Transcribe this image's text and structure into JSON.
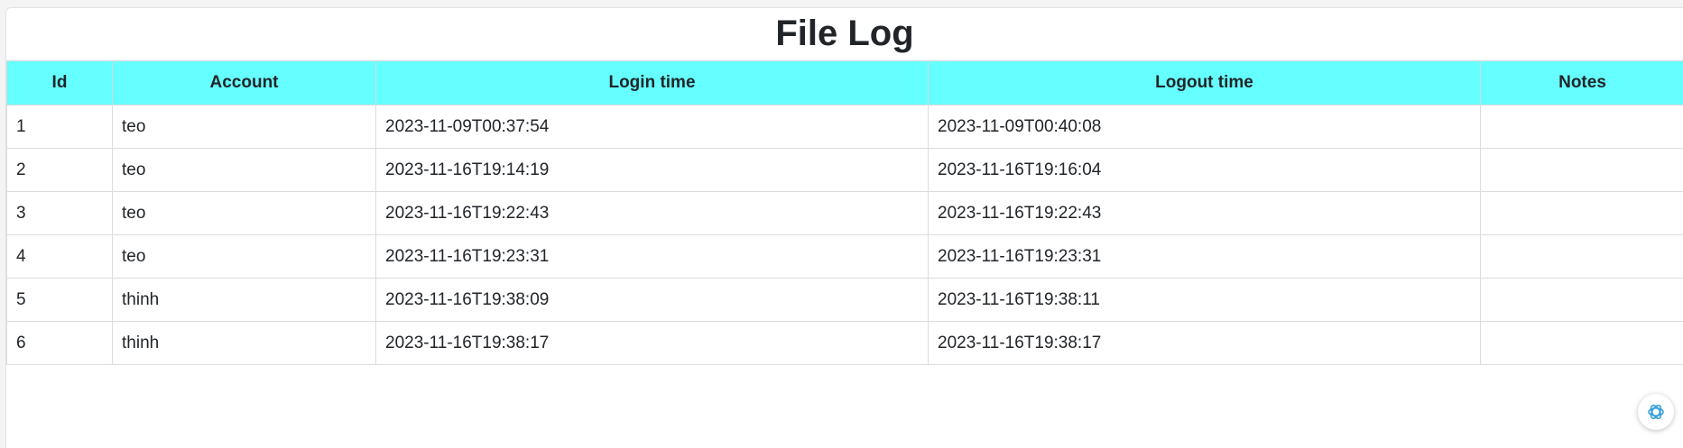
{
  "page": {
    "title": "File Log"
  },
  "colors": {
    "header_bg": "#66ffff",
    "accent": "#3aa0d8"
  },
  "table": {
    "columns": [
      "Id",
      "Account",
      "Login time",
      "Logout time",
      "Notes"
    ],
    "rows": [
      {
        "id": "1",
        "account": "teo",
        "login": "2023-11-09T00:37:54",
        "logout": "2023-11-09T00:40:08",
        "notes": ""
      },
      {
        "id": "2",
        "account": "teo",
        "login": "2023-11-16T19:14:19",
        "logout": "2023-11-16T19:16:04",
        "notes": ""
      },
      {
        "id": "3",
        "account": "teo",
        "login": "2023-11-16T19:22:43",
        "logout": "2023-11-16T19:22:43",
        "notes": ""
      },
      {
        "id": "4",
        "account": "teo",
        "login": "2023-11-16T19:23:31",
        "logout": "2023-11-16T19:23:31",
        "notes": ""
      },
      {
        "id": "5",
        "account": "thinh",
        "login": "2023-11-16T19:38:09",
        "logout": "2023-11-16T19:38:11",
        "notes": ""
      },
      {
        "id": "6",
        "account": "thinh",
        "login": "2023-11-16T19:38:17",
        "logout": "2023-11-16T19:38:17",
        "notes": ""
      }
    ]
  },
  "widget": {
    "icon": "chatgpt-assistant-icon"
  }
}
